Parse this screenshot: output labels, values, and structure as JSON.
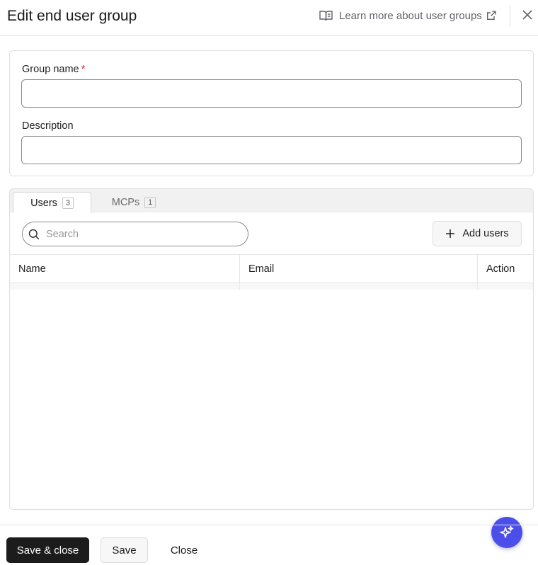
{
  "header": {
    "title": "Edit end user group",
    "learn_more": "Learn more about user groups"
  },
  "form": {
    "group_name_label": "Group name",
    "required_marker": "*",
    "group_name_value": "",
    "description_label": "Description",
    "description_value": ""
  },
  "tabs": [
    {
      "label": "Users",
      "count": "3",
      "active": true
    },
    {
      "label": "MCPs",
      "count": "1",
      "active": false
    }
  ],
  "users_panel": {
    "search_placeholder": "Search",
    "add_users_label": "Add users",
    "columns": [
      "Name",
      "Email",
      "Action"
    ]
  },
  "footer": {
    "save_close_label": "Save & close",
    "save_label": "Save",
    "close_label": "Close"
  },
  "colors": {
    "primary_button": "#1c1c1c",
    "ai_fab": "#4b4ee8",
    "required": "#d93025"
  },
  "icons": {
    "learn_more": "book-open-icon",
    "external": "external-link-icon",
    "close": "close-icon",
    "search": "search-icon",
    "add": "plus-icon",
    "ai": "sparkle-icon"
  }
}
